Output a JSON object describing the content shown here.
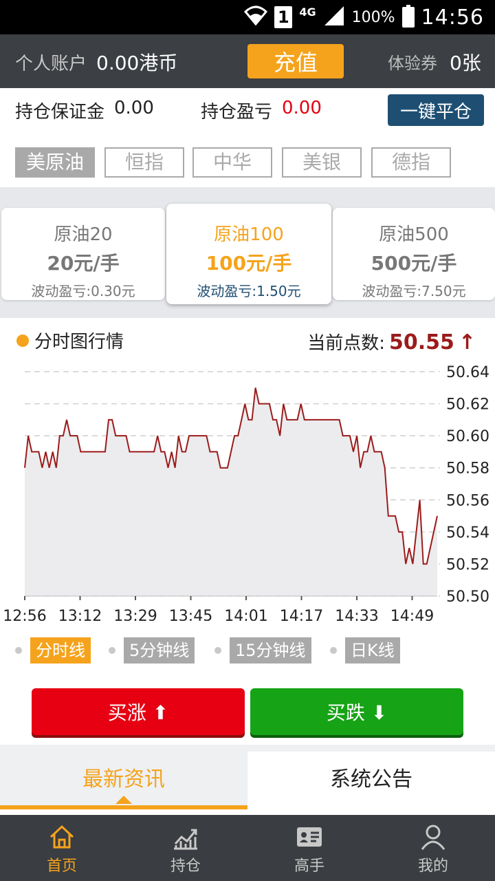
{
  "status": {
    "network": "4G",
    "sim": "1",
    "battery": "100%",
    "time": "14:56"
  },
  "account": {
    "label": "个人账户",
    "value": "0.00港币",
    "recharge": "充值",
    "voucher_label": "体验券",
    "voucher_value": "0张"
  },
  "margin": {
    "margin_label": "持仓保证金",
    "margin_value": "0.00",
    "pnl_label": "持仓盈亏",
    "pnl_value": "0.00",
    "close_all": "一键平仓"
  },
  "commodities": [
    "美原油",
    "恒指",
    "中华",
    "美银",
    "德指"
  ],
  "products": [
    {
      "name": "原油20",
      "price": "20元/手",
      "fluct": "波动盈亏:0.30元"
    },
    {
      "name": "原油100",
      "price": "100元/手",
      "fluct": "波动盈亏:1.50元"
    },
    {
      "name": "原油500",
      "price": "500元/手",
      "fluct": "波动盈亏:7.50元"
    }
  ],
  "chart_header": {
    "title": "分时图行情",
    "current_label": "当前点数:",
    "current_value": "50.55",
    "arrow": "↑"
  },
  "kline_tabs": [
    "分时线",
    "5分钟线",
    "15分钟线",
    "日K线"
  ],
  "buttons": {
    "buy_up": "买涨 ⬆",
    "buy_down": "买跌 ⬇"
  },
  "news_tabs": [
    "最新资讯",
    "系统公告"
  ],
  "nav": [
    "首页",
    "持仓",
    "高手",
    "我的"
  ],
  "colors": {
    "accent": "#f5a31c",
    "up": "#e60012",
    "down": "#16a316",
    "line": "#9b1b1b"
  },
  "chart_data": {
    "type": "line",
    "x_ticks": [
      "12:56",
      "13:12",
      "13:29",
      "13:45",
      "14:01",
      "14:17",
      "14:33",
      "14:49"
    ],
    "y_ticks": [
      "50.64",
      "50.62",
      "50.60",
      "50.58",
      "50.56",
      "50.54",
      "50.52",
      "50.50"
    ],
    "ylim": [
      50.5,
      50.64
    ],
    "grid": true,
    "values": [
      50.58,
      50.6,
      50.59,
      50.59,
      50.59,
      50.58,
      50.59,
      50.58,
      50.59,
      50.58,
      50.6,
      50.6,
      50.61,
      50.6,
      50.6,
      50.6,
      50.59,
      50.59,
      50.59,
      50.59,
      50.59,
      50.59,
      50.59,
      50.59,
      50.61,
      50.61,
      50.6,
      50.6,
      50.6,
      50.6,
      50.59,
      50.59,
      50.59,
      50.59,
      50.59,
      50.59,
      50.59,
      50.59,
      50.6,
      50.59,
      50.59,
      50.58,
      50.59,
      50.58,
      50.6,
      50.59,
      50.59,
      50.6,
      50.6,
      50.6,
      50.6,
      50.6,
      50.6,
      50.59,
      50.59,
      50.59,
      50.58,
      50.58,
      50.58,
      50.59,
      50.6,
      50.6,
      50.61,
      50.62,
      50.61,
      50.61,
      50.63,
      50.62,
      50.62,
      50.62,
      50.62,
      50.61,
      50.61,
      50.6,
      50.62,
      50.61,
      50.61,
      50.61,
      50.61,
      50.62,
      50.61,
      50.61,
      50.61,
      50.61,
      50.61,
      50.61,
      50.61,
      50.61,
      50.61,
      50.61,
      50.61,
      50.6,
      50.6,
      50.6,
      50.59,
      50.6,
      50.58,
      50.59,
      50.59,
      50.6,
      50.59,
      50.59,
      50.59,
      50.58,
      50.55,
      50.55,
      50.55,
      50.54,
      50.54,
      50.52,
      50.53,
      50.52,
      50.54,
      50.56,
      50.52,
      50.52,
      50.53,
      50.54,
      50.55
    ]
  }
}
